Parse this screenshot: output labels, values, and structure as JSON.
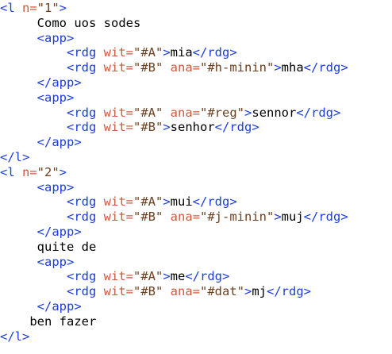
{
  "lines": [
    {
      "indent": 0,
      "parts": [
        {
          "k": "t",
          "v": "<l "
        },
        {
          "k": "an",
          "v": "n="
        },
        {
          "k": "av",
          "v": "\"1\""
        },
        {
          "k": "t",
          "v": ">"
        }
      ]
    },
    {
      "indent": 5,
      "parts": [
        {
          "k": "tx",
          "v": "Como uos sodes"
        }
      ]
    },
    {
      "indent": 5,
      "parts": [
        {
          "k": "t",
          "v": "<app>"
        }
      ]
    },
    {
      "indent": 9,
      "parts": [
        {
          "k": "t",
          "v": "<rdg "
        },
        {
          "k": "an",
          "v": "wit="
        },
        {
          "k": "av",
          "v": "\"#A\""
        },
        {
          "k": "t",
          "v": ">"
        },
        {
          "k": "tx",
          "v": "mia"
        },
        {
          "k": "t",
          "v": "</rdg>"
        }
      ]
    },
    {
      "indent": 9,
      "parts": [
        {
          "k": "t",
          "v": "<rdg "
        },
        {
          "k": "an",
          "v": "wit="
        },
        {
          "k": "av",
          "v": "\"#B\""
        },
        {
          "k": "tx",
          "v": " "
        },
        {
          "k": "an",
          "v": "ana="
        },
        {
          "k": "av",
          "v": "\"#h-minin\""
        },
        {
          "k": "t",
          "v": ">"
        },
        {
          "k": "tx",
          "v": "mha"
        },
        {
          "k": "t",
          "v": "</rdg>"
        }
      ]
    },
    {
      "indent": 5,
      "parts": [
        {
          "k": "t",
          "v": "</app>"
        }
      ]
    },
    {
      "indent": 5,
      "parts": [
        {
          "k": "t",
          "v": "<app>"
        }
      ]
    },
    {
      "indent": 9,
      "parts": [
        {
          "k": "t",
          "v": "<rdg "
        },
        {
          "k": "an",
          "v": "wit="
        },
        {
          "k": "av",
          "v": "\"#A\""
        },
        {
          "k": "tx",
          "v": " "
        },
        {
          "k": "an",
          "v": "ana="
        },
        {
          "k": "av",
          "v": "\"#reg\""
        },
        {
          "k": "t",
          "v": ">"
        },
        {
          "k": "tx",
          "v": "sennor"
        },
        {
          "k": "t",
          "v": "</rdg>"
        }
      ]
    },
    {
      "indent": 9,
      "parts": [
        {
          "k": "t",
          "v": "<rdg "
        },
        {
          "k": "an",
          "v": "wit="
        },
        {
          "k": "av",
          "v": "\"#B\""
        },
        {
          "k": "t",
          "v": ">"
        },
        {
          "k": "tx",
          "v": "senhor"
        },
        {
          "k": "t",
          "v": "</rdg>"
        }
      ]
    },
    {
      "indent": 5,
      "parts": [
        {
          "k": "t",
          "v": "</app>"
        }
      ]
    },
    {
      "indent": 0,
      "parts": [
        {
          "k": "t",
          "v": "</l>"
        }
      ]
    },
    {
      "indent": 0,
      "parts": [
        {
          "k": "t",
          "v": "<l "
        },
        {
          "k": "an",
          "v": "n="
        },
        {
          "k": "av",
          "v": "\"2\""
        },
        {
          "k": "t",
          "v": ">"
        }
      ]
    },
    {
      "indent": 5,
      "parts": [
        {
          "k": "t",
          "v": "<app>"
        }
      ]
    },
    {
      "indent": 9,
      "parts": [
        {
          "k": "t",
          "v": "<rdg "
        },
        {
          "k": "an",
          "v": "wit="
        },
        {
          "k": "av",
          "v": "\"#A\""
        },
        {
          "k": "t",
          "v": ">"
        },
        {
          "k": "tx",
          "v": "mui"
        },
        {
          "k": "t",
          "v": "</rdg>"
        }
      ]
    },
    {
      "indent": 9,
      "parts": [
        {
          "k": "t",
          "v": "<rdg "
        },
        {
          "k": "an",
          "v": "wit="
        },
        {
          "k": "av",
          "v": "\"#B\""
        },
        {
          "k": "tx",
          "v": " "
        },
        {
          "k": "an",
          "v": "ana="
        },
        {
          "k": "av",
          "v": "\"#j-minin\""
        },
        {
          "k": "t",
          "v": ">"
        },
        {
          "k": "tx",
          "v": "muj"
        },
        {
          "k": "t",
          "v": "</rdg>"
        }
      ]
    },
    {
      "indent": 5,
      "parts": [
        {
          "k": "t",
          "v": "</app>"
        }
      ]
    },
    {
      "indent": 5,
      "parts": [
        {
          "k": "tx",
          "v": "quite de"
        }
      ]
    },
    {
      "indent": 5,
      "parts": [
        {
          "k": "t",
          "v": "<app>"
        }
      ]
    },
    {
      "indent": 9,
      "parts": [
        {
          "k": "t",
          "v": "<rdg "
        },
        {
          "k": "an",
          "v": "wit="
        },
        {
          "k": "av",
          "v": "\"#A\""
        },
        {
          "k": "t",
          "v": ">"
        },
        {
          "k": "tx",
          "v": "me"
        },
        {
          "k": "t",
          "v": "</rdg>"
        }
      ]
    },
    {
      "indent": 9,
      "parts": [
        {
          "k": "t",
          "v": "<rdg "
        },
        {
          "k": "an",
          "v": "wit="
        },
        {
          "k": "av",
          "v": "\"#B\""
        },
        {
          "k": "tx",
          "v": " "
        },
        {
          "k": "an",
          "v": "ana="
        },
        {
          "k": "av",
          "v": "\"#dat\""
        },
        {
          "k": "t",
          "v": ">"
        },
        {
          "k": "tx",
          "v": "mj"
        },
        {
          "k": "t",
          "v": "</rdg>"
        }
      ]
    },
    {
      "indent": 5,
      "parts": [
        {
          "k": "t",
          "v": "</app>"
        }
      ]
    },
    {
      "indent": 4,
      "parts": [
        {
          "k": "tx",
          "v": "ben fazer"
        }
      ]
    },
    {
      "indent": 0,
      "parts": [
        {
          "k": "t",
          "v": "</l>"
        }
      ]
    }
  ],
  "colors": {
    "tag": "#1d3ee0",
    "attr_name": "#cc5a3c",
    "attr_value": "#6d3f1f",
    "text": "#000000"
  }
}
